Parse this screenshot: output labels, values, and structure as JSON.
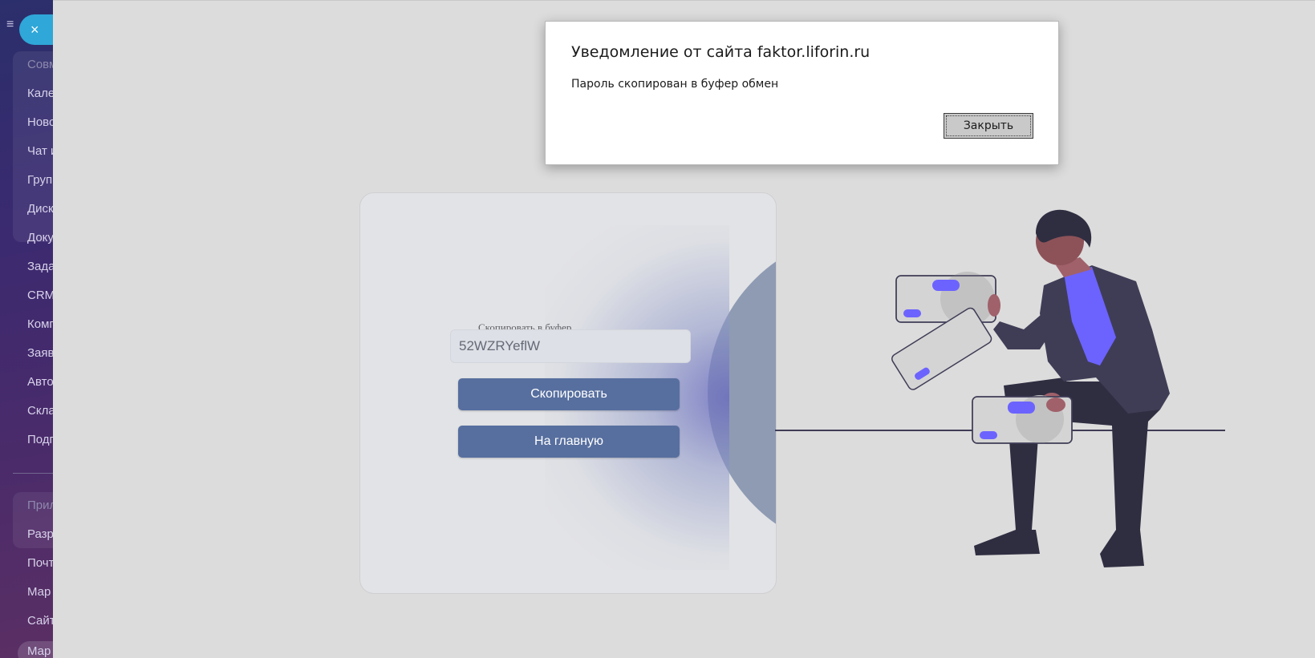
{
  "sidebar": {
    "close_icon": "×",
    "menu_icon": "≡",
    "items": [
      {
        "label": "Совм",
        "dim": true
      },
      {
        "label": "Кале"
      },
      {
        "label": "Ново"
      },
      {
        "label": "Чат и"
      },
      {
        "label": "Груп"
      },
      {
        "label": "Диск"
      },
      {
        "label": "Доку"
      },
      {
        "label": "Зада"
      },
      {
        "label": "CRM"
      },
      {
        "label": "Комг"
      },
      {
        "label": "Заяв"
      },
      {
        "label": "Авто"
      },
      {
        "label": "Скла"
      },
      {
        "label": "Подг"
      },
      {
        "label": "Прил",
        "dim": true
      },
      {
        "label": "Разр"
      },
      {
        "label": "Почт"
      },
      {
        "label": "Мар"
      },
      {
        "label": "Сайт"
      },
      {
        "label": "Мар"
      }
    ]
  },
  "card": {
    "field_label": "Скопировать в буфер",
    "password_value": "52WZRYeflW",
    "copy_button": "Скопировать",
    "home_button": "На главную"
  },
  "dialog": {
    "title": "Уведомление от сайта faktor.liforin.ru",
    "message": "Пароль скопирован в буфер обмен",
    "close_button": "Закрыть"
  },
  "colors": {
    "accent_button": "#576f9f",
    "fab": "#2fa7d8",
    "illustration_accent": "#6c63ff",
    "illustration_dark": "#2f2e41"
  }
}
